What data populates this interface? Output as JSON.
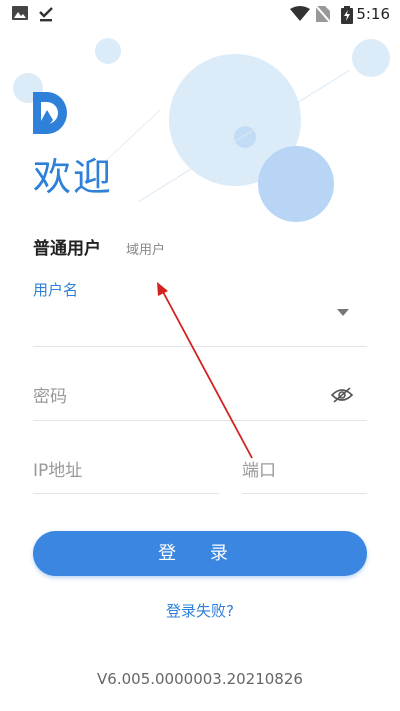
{
  "status_bar": {
    "time": "5:16"
  },
  "header": {
    "welcome": "欢迎"
  },
  "tabs": {
    "normal_user": "普通用户",
    "domain_user": "域用户"
  },
  "form": {
    "username_label": "用户名",
    "password_placeholder": "密码",
    "ip_placeholder": "IP地址",
    "port_placeholder": "端口"
  },
  "actions": {
    "login": "登 录",
    "login_failed": "登录失败?"
  },
  "footer": {
    "version": "V6.005.0000003.20210826"
  },
  "colors": {
    "accent": "#2f80d8",
    "button": "#3a86e0",
    "annotation_arrow": "#d32020"
  },
  "icons": [
    "image-icon",
    "download-done-icon",
    "wifi-icon",
    "no-sim-icon",
    "battery-charging-icon",
    "app-logo-icon",
    "dropdown-arrow-icon",
    "eye-off-icon"
  ]
}
